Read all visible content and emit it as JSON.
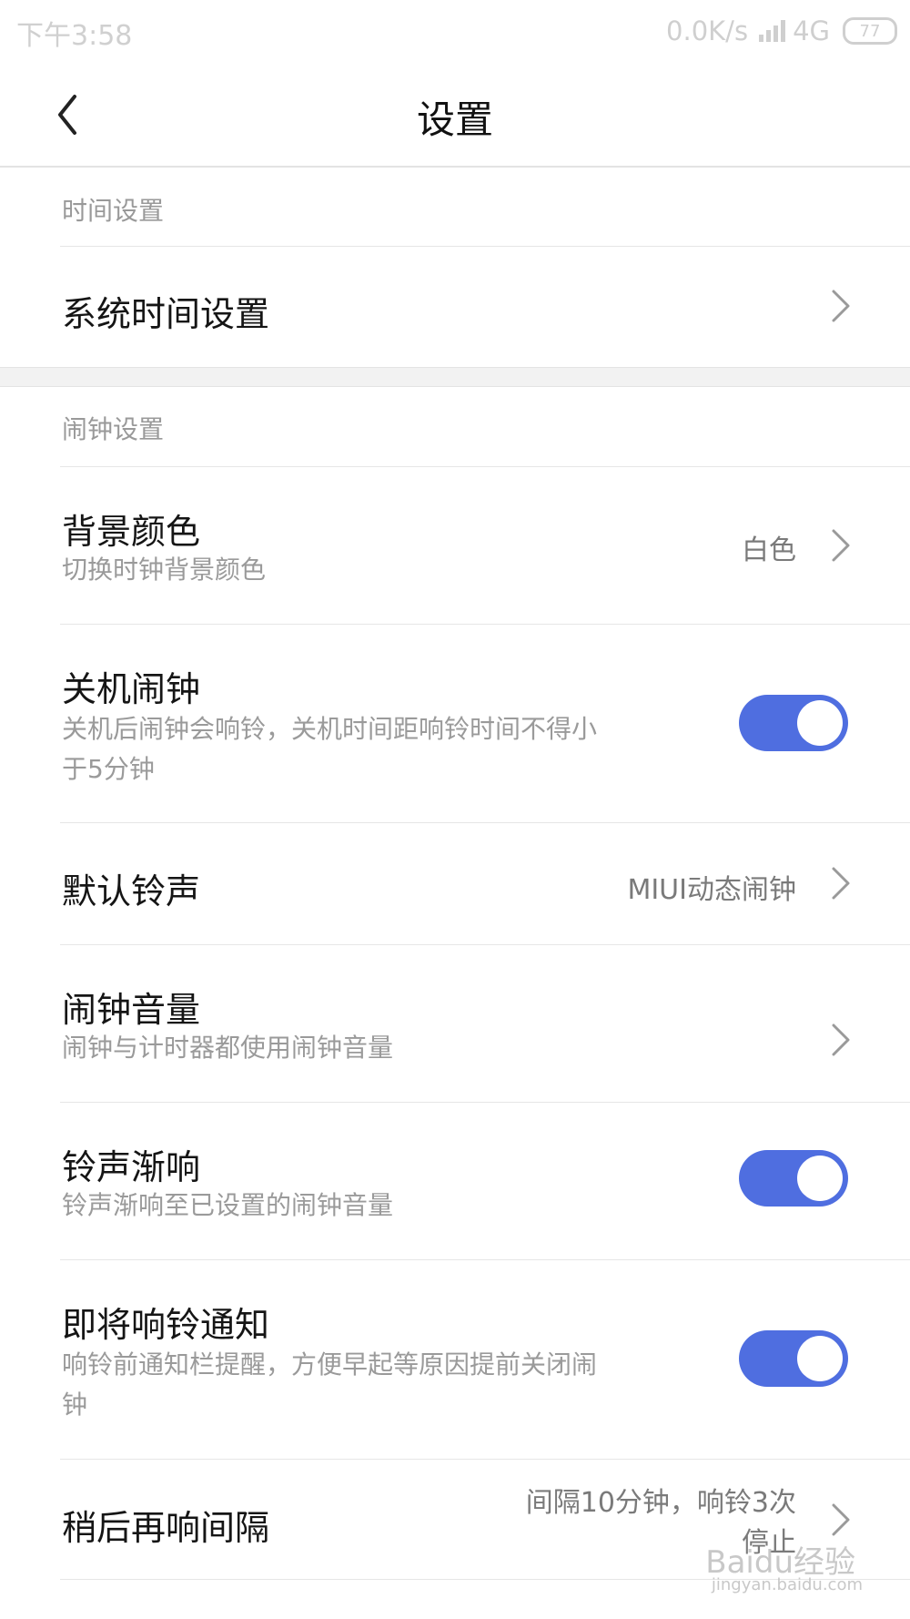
{
  "status_bar": {
    "time": "下午3:58",
    "speed": "0.0K/s",
    "network": "4G",
    "battery": "77"
  },
  "header": {
    "title": "设置"
  },
  "sections": {
    "time_settings": {
      "label": "时间设置",
      "system_time": {
        "title": "系统时间设置"
      }
    },
    "alarm_settings": {
      "label": "闹钟设置",
      "background_color": {
        "title": "背景颜色",
        "subtitle": "切换时钟背景颜色",
        "value": "白色"
      },
      "shutdown_alarm": {
        "title": "关机闹钟",
        "subtitle_line1": "关机后闹钟会响铃，关机时间距响铃时间不得小",
        "subtitle_line2": "于5分钟",
        "enabled": true
      },
      "default_ringtone": {
        "title": "默认铃声",
        "value": "MIUI动态闹钟"
      },
      "alarm_volume": {
        "title": "闹钟音量",
        "subtitle": "闹钟与计时器都使用闹钟音量"
      },
      "ring_fade_in": {
        "title": "铃声渐响",
        "subtitle": "铃声渐响至已设置的闹钟音量",
        "enabled": true
      },
      "upcoming_notice": {
        "title": "即将响铃通知",
        "subtitle_line1": "响铃前通知栏提醒，方便早起等原因提前关闭闹",
        "subtitle_line2": "钟",
        "enabled": true
      },
      "snooze_interval": {
        "title": "稍后再响间隔",
        "value_line1": "间隔10分钟，响铃3次",
        "value_line2": "停止"
      }
    }
  },
  "watermark": {
    "text": "Baidu经验",
    "url": "jingyan.baidu.com"
  },
  "colors": {
    "toggle_on": "#4f6ee0",
    "secondary_text": "#9a9a9a"
  }
}
